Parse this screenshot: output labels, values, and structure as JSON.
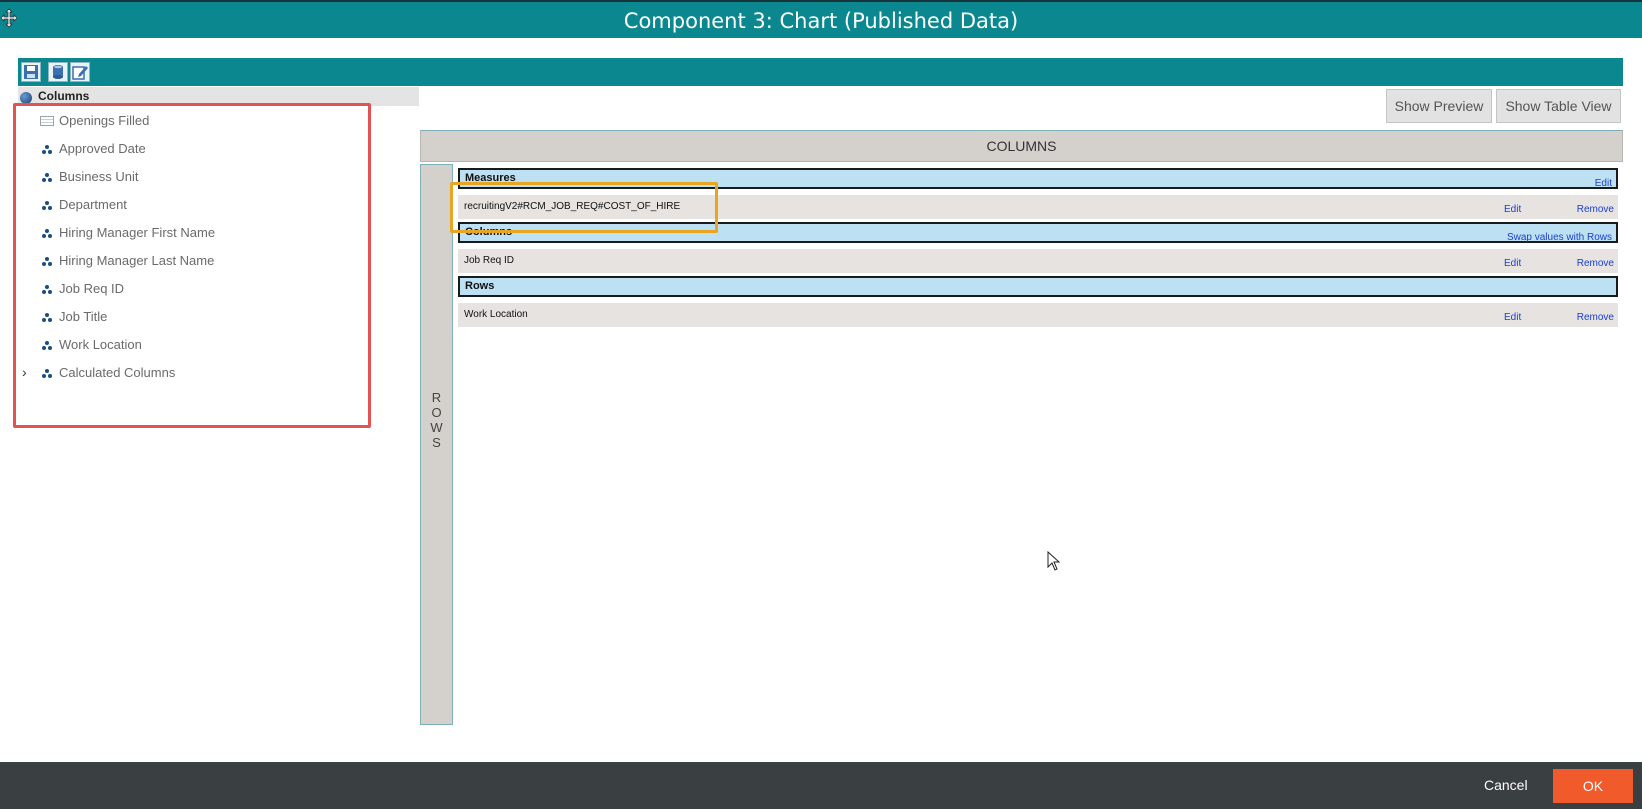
{
  "window": {
    "title": "Component 3: Chart (Published Data)"
  },
  "toolbar": {
    "buttons": [
      "save-icon",
      "database-icon",
      "edit-icon"
    ]
  },
  "tree": {
    "header": "Columns",
    "items": [
      {
        "label": "Openings Filled",
        "icon": "table-icon"
      },
      {
        "label": "Approved Date",
        "icon": "dimension-icon"
      },
      {
        "label": "Business Unit",
        "icon": "dimension-icon"
      },
      {
        "label": "Department",
        "icon": "dimension-icon"
      },
      {
        "label": "Hiring Manager First Name",
        "icon": "dimension-icon"
      },
      {
        "label": "Hiring Manager Last Name",
        "icon": "dimension-icon"
      },
      {
        "label": "Job Req ID",
        "icon": "dimension-icon"
      },
      {
        "label": "Job Title",
        "icon": "dimension-icon"
      },
      {
        "label": "Work Location",
        "icon": "dimension-icon"
      },
      {
        "label": "Calculated Columns",
        "icon": "dimension-icon"
      }
    ]
  },
  "actions": {
    "show_preview": "Show Preview",
    "show_table_view": "Show Table View"
  },
  "designer": {
    "columns_header": "COLUMNS",
    "rows_header": "ROWS",
    "measures": {
      "label": "Measures",
      "action": "Edit",
      "item": "recruitingV2#RCM_JOB_REQ#COST_OF_HIRE"
    },
    "columns": {
      "label": "Columns",
      "action": "Swap values with Rows",
      "item": "Job Req ID"
    },
    "rows": {
      "label": "Rows",
      "item": "Work Location"
    },
    "edit_label": "Edit",
    "remove_label": "Remove"
  },
  "footer": {
    "cancel": "Cancel",
    "ok": "OK"
  },
  "colors": {
    "title_bar": "#0b8790",
    "ok_button": "#f15a2b",
    "footer": "#3a3f42",
    "highlight_red": "#e25454",
    "highlight_orange": "#e8a521"
  }
}
